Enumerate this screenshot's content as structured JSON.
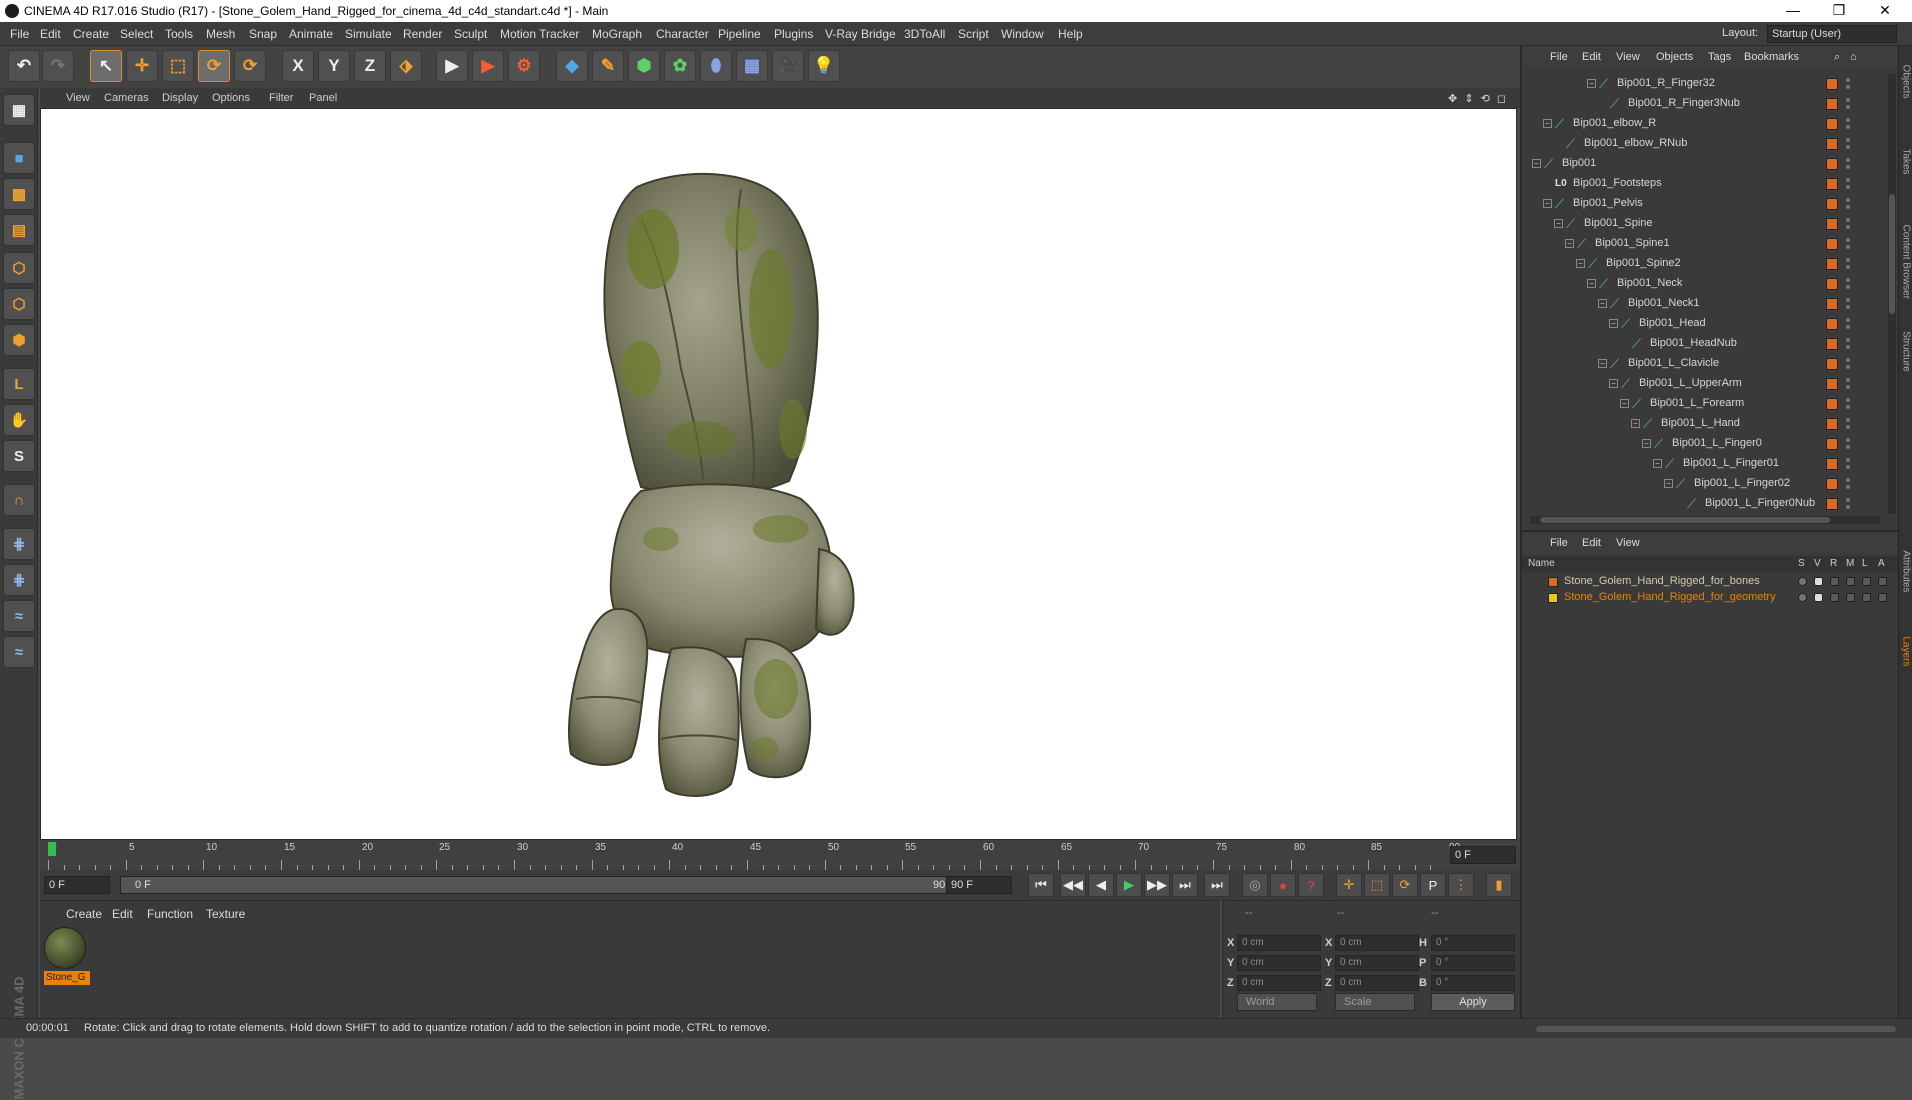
{
  "window": {
    "title": "CINEMA 4D R17.016 Studio (R17) - [Stone_Golem_Hand_Rigged_for_cinema_4d_c4d_standart.c4d *] - Main",
    "minimize": "—",
    "maximize": "❐",
    "close": "✕"
  },
  "menu": {
    "items": [
      "File",
      "Edit",
      "Create",
      "Select",
      "Tools",
      "Mesh",
      "Snap",
      "Animate",
      "Simulate",
      "Render",
      "Sculpt",
      "Motion Tracker",
      "MoGraph",
      "Character",
      "Pipeline",
      "Plugins",
      "V-Ray Bridge",
      "3DToAll",
      "Script",
      "Window",
      "Help"
    ],
    "layout_label": "Layout:",
    "layout_value": "Startup (User)"
  },
  "toolbar": {
    "undo": "↶",
    "redo": "↷",
    "live_select": "↖",
    "move": "✛",
    "scale": "⬚",
    "rotate": "⟳",
    "recent": "⟳",
    "lock_x": "X",
    "lock_y": "Y",
    "lock_z": "Z",
    "coord_system": "⬗",
    "render_view": "▶",
    "render_picture": "▶",
    "render_settings": "⚙",
    "cube": "◆",
    "pen": "✎",
    "subdiv": "⬢",
    "array": "✿",
    "deformer": "⬮",
    "floor": "▦",
    "camera": "🎥",
    "light": "💡"
  },
  "left_tools": {
    "make_editable": "▦",
    "model": "■",
    "texture": "▩",
    "workplane": "▤",
    "points": "⬡",
    "edges": "⬡",
    "polygons": "⬢",
    "axis": "L",
    "tweak": "✋",
    "snap": "S",
    "magnet": "∩",
    "grid_lock": "⋕",
    "grid_snap": "⋕",
    "python1": "≈",
    "python2": "≈",
    "brand": "MAXON CINEMA 4D"
  },
  "viewport": {
    "menu": [
      "View",
      "Cameras",
      "Display",
      "Options",
      "Filter",
      "Panel"
    ],
    "nav": "✥ ⇕ ⟲ ◻"
  },
  "timeline": {
    "ticks": [
      "0",
      "5",
      "10",
      "15",
      "20",
      "25",
      "30",
      "35",
      "40",
      "45",
      "50",
      "55",
      "60",
      "65",
      "70",
      "75",
      "80",
      "85",
      "90"
    ],
    "current_frame": "0 F"
  },
  "transport": {
    "start_field": "0 F",
    "range_start": "0 F",
    "range_end": "90 F",
    "end_field": "90 F",
    "buttons": [
      "⏮",
      "◀◀",
      "◀",
      "▶",
      "▶▶",
      "⏭",
      "⏭"
    ]
  },
  "materials": {
    "menu": [
      "Create",
      "Edit",
      "Function",
      "Texture"
    ],
    "items": [
      {
        "label": "Stone_G"
      }
    ]
  },
  "coordinates": {
    "headers": [
      "--",
      "--",
      "--"
    ],
    "rows": [
      {
        "l1": "X",
        "v1": "0 cm",
        "l2": "X",
        "v2": "0 cm",
        "l3": "H",
        "v3": "0 °"
      },
      {
        "l1": "Y",
        "v1": "0 cm",
        "l2": "Y",
        "v2": "0 cm",
        "l3": "P",
        "v3": "0 °"
      },
      {
        "l1": "Z",
        "v1": "0 cm",
        "l2": "Z",
        "v2": "0 cm",
        "l3": "B",
        "v3": "0 °"
      }
    ],
    "mode": "World",
    "scale": "Scale",
    "apply": "Apply"
  },
  "status": {
    "time": "00:00:01",
    "message": "Rotate: Click and drag to rotate elements. Hold down SHIFT to add to quantize rotation / add to the selection in point mode, CTRL to remove."
  },
  "object_manager": {
    "menu": [
      "File",
      "Edit",
      "View",
      "Objects",
      "Tags",
      "Bookmarks"
    ],
    "rows": [
      {
        "name": "Bip001_R_Finger32",
        "depth": 5,
        "exp": "−"
      },
      {
        "name": "Bip001_R_Finger3Nub",
        "depth": 6,
        "exp": ""
      },
      {
        "name": "Bip001_elbow_R",
        "depth": 1,
        "exp": "−"
      },
      {
        "name": "Bip001_elbow_RNub",
        "depth": 2,
        "exp": ""
      },
      {
        "name": "Bip001",
        "depth": 0,
        "exp": "−"
      },
      {
        "name": "Bip001_Footsteps",
        "depth": 1,
        "exp": "",
        "icon": "L0"
      },
      {
        "name": "Bip001_Pelvis",
        "depth": 1,
        "exp": "−"
      },
      {
        "name": "Bip001_Spine",
        "depth": 2,
        "exp": "−"
      },
      {
        "name": "Bip001_Spine1",
        "depth": 3,
        "exp": "−"
      },
      {
        "name": "Bip001_Spine2",
        "depth": 4,
        "exp": "−"
      },
      {
        "name": "Bip001_Neck",
        "depth": 5,
        "exp": "−"
      },
      {
        "name": "Bip001_Neck1",
        "depth": 6,
        "exp": "−"
      },
      {
        "name": "Bip001_Head",
        "depth": 7,
        "exp": "−"
      },
      {
        "name": "Bip001_HeadNub",
        "depth": 8,
        "exp": ""
      },
      {
        "name": "Bip001_L_Clavicle",
        "depth": 6,
        "exp": "−"
      },
      {
        "name": "Bip001_L_UpperArm",
        "depth": 7,
        "exp": "−"
      },
      {
        "name": "Bip001_L_Forearm",
        "depth": 8,
        "exp": "−"
      },
      {
        "name": "Bip001_L_Hand",
        "depth": 9,
        "exp": "−"
      },
      {
        "name": "Bip001_L_Finger0",
        "depth": 10,
        "exp": "−"
      },
      {
        "name": "Bip001_L_Finger01",
        "depth": 11,
        "exp": "−"
      },
      {
        "name": "Bip001_L_Finger02",
        "depth": 12,
        "exp": "−"
      },
      {
        "name": "Bip001_L_Finger0Nub",
        "depth": 13,
        "exp": ""
      }
    ]
  },
  "layer_manager": {
    "menu": [
      "File",
      "Edit",
      "View"
    ],
    "columns": {
      "name": "Name",
      "s": "S",
      "v": "V",
      "r": "R",
      "m": "M",
      "l": "L",
      "a": "A"
    },
    "layers": [
      {
        "name": "Stone_Golem_Hand_Rigged_for_bones",
        "color": "#d86a22",
        "text_color": "#d7c9a8"
      },
      {
        "name": "Stone_Golem_Hand_Rigged_for_geometry",
        "color": "#e8c620",
        "text_color": "#e8820c"
      }
    ]
  },
  "right_tabs": [
    "Objects",
    "Takes",
    "Content Browser",
    "Structure",
    "Attributes",
    "Layers"
  ],
  "colors": {
    "accent": "#e8820c",
    "bone_green": "#59c26a",
    "layer_orange": "#d86a22"
  }
}
